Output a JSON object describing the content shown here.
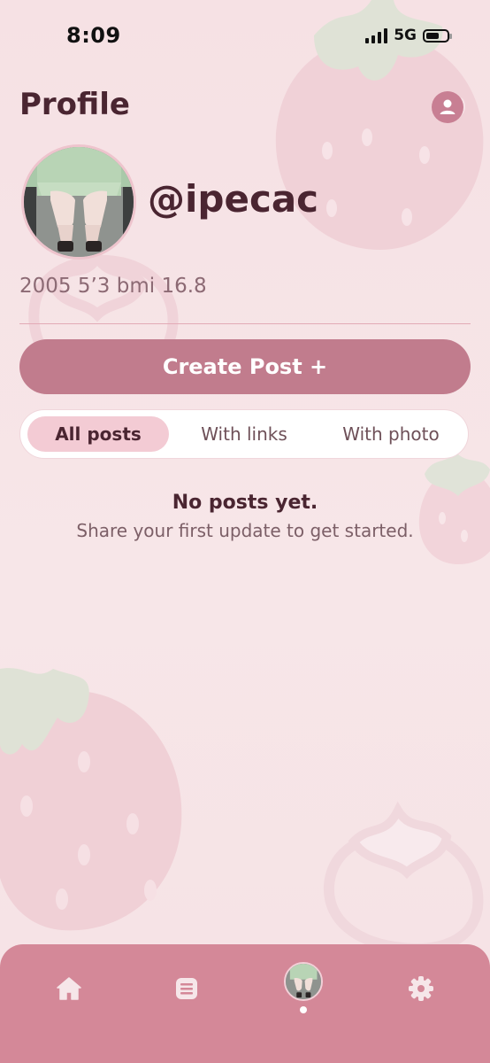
{
  "status_bar": {
    "time": "8:09",
    "network": "5G",
    "battery_level": 0.65
  },
  "header": {
    "title": "Profile",
    "account_icon": "account-circle-icon"
  },
  "profile": {
    "avatar_icon": "profile-photo",
    "username": "@ipecac",
    "bio": "2005 5’3 bmi 16.8"
  },
  "actions": {
    "create_post_label": "Create Post +"
  },
  "tabs": [
    {
      "label": "All posts",
      "active": true
    },
    {
      "label": "With links",
      "active": false
    },
    {
      "label": "With photo",
      "active": false
    }
  ],
  "empty_state": {
    "title": "No posts yet.",
    "subtitle": "Share your first update to get started."
  },
  "bottom_nav": {
    "items": [
      {
        "icon": "home-icon",
        "active": false
      },
      {
        "icon": "list-icon",
        "active": false
      },
      {
        "icon": "profile-avatar",
        "active": true
      },
      {
        "icon": "settings-gear-icon",
        "active": false
      }
    ]
  },
  "colors": {
    "background": "#f6e3e5",
    "primary": "#c17c8d",
    "nav_bar": "#d48898",
    "text_dark": "#4a2531",
    "strawberry": "#f2d2d8",
    "leaf": "#dfe3d6"
  }
}
